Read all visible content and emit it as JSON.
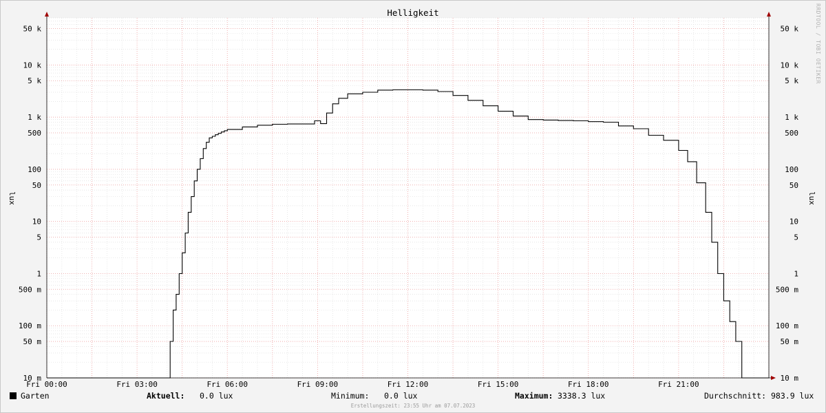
{
  "chart_data": {
    "type": "line",
    "title": "Helligkeit",
    "ylabel": "lux",
    "xlabel": "",
    "scale": "log",
    "ylim": [
      0.01,
      80000
    ],
    "xlim_hours": [
      0,
      24
    ],
    "x_ticks": [
      "Fri 00:00",
      "Fri 03:00",
      "Fri 06:00",
      "Fri 09:00",
      "Fri 12:00",
      "Fri 15:00",
      "Fri 18:00",
      "Fri 21:00"
    ],
    "y_ticks": [
      {
        "label": "10 m",
        "value": 0.01
      },
      {
        "label": "50 m",
        "value": 0.05
      },
      {
        "label": "100 m",
        "value": 0.1
      },
      {
        "label": "500 m",
        "value": 0.5
      },
      {
        "label": "1",
        "value": 1
      },
      {
        "label": "5",
        "value": 5
      },
      {
        "label": "10",
        "value": 10
      },
      {
        "label": "50",
        "value": 50
      },
      {
        "label": "100",
        "value": 100
      },
      {
        "label": "500",
        "value": 500
      },
      {
        "label": "1 k",
        "value": 1000
      },
      {
        "label": "5 k",
        "value": 5000
      },
      {
        "label": "10 k",
        "value": 10000
      },
      {
        "label": "50 k",
        "value": 50000
      }
    ],
    "grid": true,
    "series": [
      {
        "name": "Garten",
        "color": "#000000",
        "x_hours": [
          0,
          4.05,
          4.1,
          4.2,
          4.3,
          4.4,
          4.5,
          4.6,
          4.7,
          4.8,
          4.9,
          5.0,
          5.1,
          5.2,
          5.3,
          5.4,
          5.5,
          5.6,
          5.7,
          5.8,
          5.9,
          6.0,
          6.5,
          7.0,
          7.5,
          8.0,
          8.5,
          8.9,
          9.1,
          9.3,
          9.5,
          9.7,
          10.0,
          10.5,
          11.0,
          11.5,
          12.0,
          12.5,
          13.0,
          13.5,
          14.0,
          14.5,
          15.0,
          15.5,
          16.0,
          16.5,
          17.0,
          17.5,
          18.0,
          18.5,
          19.0,
          19.5,
          20.0,
          20.5,
          21.0,
          21.3,
          21.6,
          21.9,
          22.1,
          22.3,
          22.5,
          22.7,
          22.9,
          23.1,
          23.2,
          23.3,
          24.0
        ],
        "values": [
          0.01,
          0.01,
          0.05,
          0.2,
          0.4,
          1.0,
          2.5,
          6.0,
          15,
          30,
          60,
          100,
          160,
          250,
          330,
          400,
          430,
          460,
          490,
          520,
          550,
          580,
          650,
          700,
          730,
          740,
          740,
          850,
          750,
          1200,
          1800,
          2300,
          2800,
          3000,
          3300,
          3338,
          3338,
          3300,
          3100,
          2600,
          2100,
          1650,
          1300,
          1050,
          900,
          880,
          860,
          850,
          820,
          800,
          680,
          600,
          450,
          360,
          230,
          140,
          55,
          15,
          4,
          1.0,
          0.3,
          0.12,
          0.05,
          0.01,
          0.01,
          0.01,
          0.01
        ]
      }
    ]
  },
  "side_label": "RRDTOOL / TOBI OETIKER",
  "legend": {
    "series_name": "Garten",
    "current_label": "Aktuell:",
    "current_value": "0.0 lux",
    "min_label": "Minimum:",
    "min_value": "0.0 lux",
    "max_label": "Maximum:",
    "max_value": "3338.3 lux",
    "avg_label": "Durchschnitt:",
    "avg_value": "983.9 lux"
  },
  "created": "Erstellungszeit: 23:55 Uhr am 07.07.2023"
}
